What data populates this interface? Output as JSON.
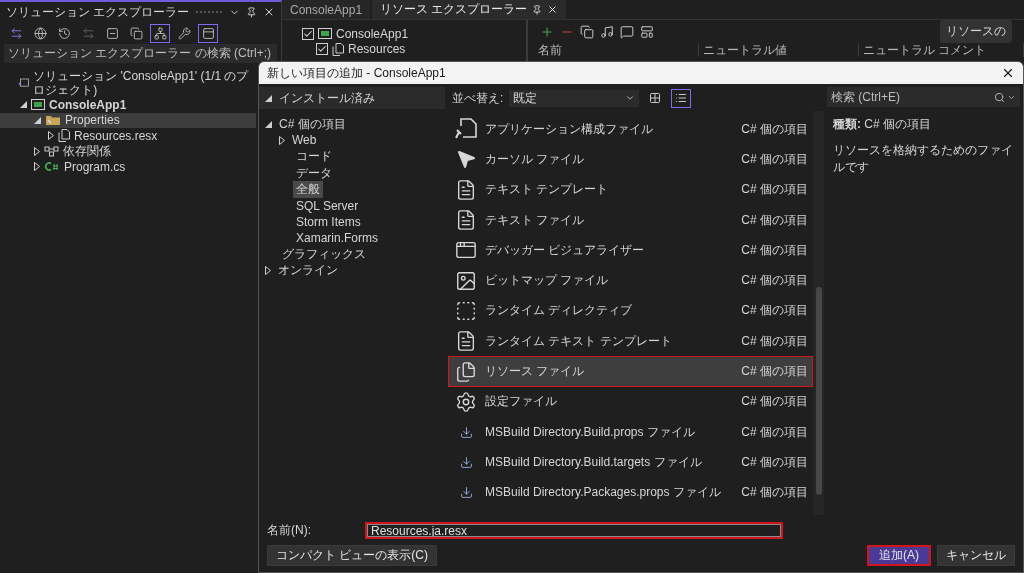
{
  "solution_explorer": {
    "title": "ソリューション エクスプローラー",
    "toolbar": [
      {
        "kind": "switch",
        "selected": false
      },
      {
        "kind": "globe",
        "selected": false
      },
      {
        "kind": "history",
        "selected": false
      },
      {
        "kind": "sync",
        "selected": false
      },
      {
        "kind": "collapse",
        "selected": false
      },
      {
        "kind": "copy",
        "selected": false
      },
      {
        "kind": "tree",
        "selected": true
      },
      {
        "kind": "wrench",
        "selected": false
      },
      {
        "kind": "preview",
        "selected": true
      }
    ],
    "search": {
      "placeholder": "ソリューション エクスプローラー の検索 (Ctrl+;)"
    },
    "tree": [
      {
        "label": "ソリューション 'ConsoleApp1' (1/1 のプロジェクト)",
        "kind": "solution",
        "expandable": false,
        "bold": false,
        "selected": false,
        "children": [
          {
            "label": "ConsoleApp1",
            "kind": "project",
            "expandable": true,
            "expanded": true,
            "bold": true,
            "selected": false,
            "children": [
              {
                "label": "Properties",
                "kind": "folder",
                "expandable": true,
                "expanded": true,
                "bold": false,
                "selected": true,
                "children": [
                  {
                    "label": "Resources.resx",
                    "kind": "resx",
                    "expandable": true,
                    "expanded": false,
                    "bold": false,
                    "selected": false
                  }
                ]
              },
              {
                "label": "依存関係",
                "kind": "dependencies",
                "expandable": true,
                "expanded": false,
                "bold": false,
                "selected": false
              },
              {
                "label": "Program.cs",
                "kind": "csharp",
                "expandable": true,
                "expanded": false,
                "bold": false,
                "selected": false
              }
            ]
          }
        ]
      }
    ]
  },
  "tabs": [
    {
      "label": "ConsoleApp1",
      "selected": false
    },
    {
      "label": "リソース エクスプローラー",
      "selected": true
    }
  ],
  "resource_explorer": {
    "tree": [
      {
        "label": "ConsoleApp1",
        "kind": "project",
        "checked": true,
        "children": [
          {
            "label": "Resources",
            "kind": "resx",
            "checked": true
          }
        ]
      }
    ],
    "toolbar": [
      {
        "kind": "add"
      },
      {
        "kind": "remove"
      },
      {
        "kind": "copy"
      },
      {
        "kind": "audio"
      },
      {
        "kind": "comment"
      },
      {
        "kind": "layout"
      }
    ],
    "side_button": "リソースの",
    "columns": [
      "名前",
      "ニュートラル値",
      "ニュートラル コメント"
    ]
  },
  "dialog": {
    "title": "新しい項目の追加 - ConsoleApp1",
    "categories": [
      {
        "label": "インストール済み",
        "expandable": true,
        "expanded": true,
        "selected": false,
        "header": true,
        "children": [
          {
            "label": "C# 個の項目",
            "expandable": true,
            "expanded": true,
            "selected": false,
            "header": false,
            "children": [
              {
                "label": "Web",
                "expandable": true,
                "expanded": false,
                "selected": false,
                "header": false
              },
              {
                "label": "コード",
                "expandable": false,
                "expanded": false,
                "selected": false,
                "header": false
              },
              {
                "label": "データ",
                "expandable": false,
                "expanded": false,
                "selected": false,
                "header": false
              },
              {
                "label": "全般",
                "expandable": false,
                "expanded": false,
                "selected": true,
                "header": false
              },
              {
                "label": "SQL Server",
                "expandable": false,
                "expanded": false,
                "selected": false,
                "header": false
              },
              {
                "label": "Storm Items",
                "expandable": false,
                "expanded": false,
                "selected": false,
                "header": false
              },
              {
                "label": "Xamarin.Forms",
                "expandable": false,
                "expanded": false,
                "selected": false,
                "header": false
              }
            ]
          },
          {
            "label": "グラフィックス",
            "expandable": false,
            "expanded": false,
            "selected": false,
            "header": false
          }
        ]
      },
      {
        "label": "オンライン",
        "expandable": true,
        "expanded": false,
        "selected": false,
        "header": false
      }
    ],
    "sort_label": "並べ替え:",
    "sort_value": "既定",
    "view_modes": [
      {
        "kind": "grid",
        "selected": false
      },
      {
        "kind": "list",
        "selected": true
      }
    ],
    "templates": [
      {
        "name": "アプリケーション構成ファイル",
        "kind": "config",
        "category": "C# 個の項目",
        "selected": false
      },
      {
        "name": "カーソル ファイル",
        "kind": "cursor",
        "category": "C# 個の項目",
        "selected": false
      },
      {
        "name": "テキスト テンプレート",
        "kind": "text",
        "category": "C# 個の項目",
        "selected": false
      },
      {
        "name": "テキスト ファイル",
        "kind": "text",
        "category": "C# 個の項目",
        "selected": false
      },
      {
        "name": "デバッガー ビジュアライザー",
        "kind": "visualizer",
        "category": "C# 個の項目",
        "selected": false
      },
      {
        "name": "ビットマップ ファイル",
        "kind": "bitmap",
        "category": "C# 個の項目",
        "selected": false
      },
      {
        "name": "ランタイム ディレクティブ",
        "kind": "directive",
        "category": "C# 個の項目",
        "selected": false
      },
      {
        "name": "ランタイム テキスト テンプレート",
        "kind": "text",
        "category": "C# 個の項目",
        "selected": false
      },
      {
        "name": "リソース ファイル",
        "kind": "resource",
        "category": "C# 個の項目",
        "selected": true
      },
      {
        "name": "設定ファイル",
        "kind": "settings",
        "category": "C# 個の項目",
        "selected": false
      },
      {
        "name": "MSBuild Directory.Build.props ファイル",
        "kind": "msbuild",
        "category": "C# 個の項目",
        "selected": false
      },
      {
        "name": "MSBuild Directory.Build.targets ファイル",
        "kind": "msbuild",
        "category": "C# 個の項目",
        "selected": false
      },
      {
        "name": "MSBuild Directory.Packages.props ファイル",
        "kind": "msbuild",
        "category": "C# 個の項目",
        "selected": false
      }
    ],
    "search": {
      "placeholder": "検索 (Ctrl+E)"
    },
    "detail": {
      "type": "**種類:** C# 個の項目",
      "description": "リソースを格納するためのファイルです"
    },
    "name_label": "名前(N):",
    "name_value": "Resources.ja.resx",
    "compact_button": "コンパクト ビューの表示(C)",
    "add_button": "追加(A)",
    "cancel_button": "キャンセル"
  }
}
